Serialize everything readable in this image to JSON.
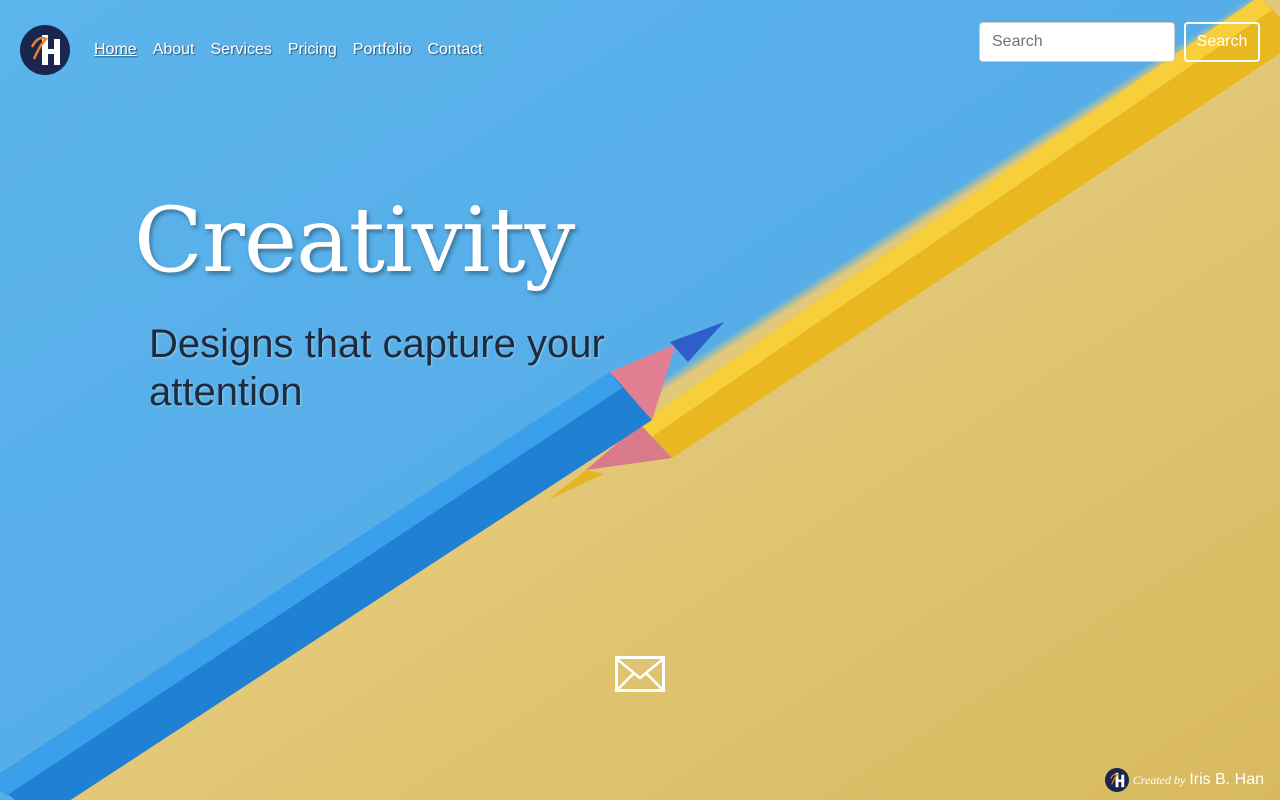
{
  "brand": {
    "logo_initials": "IBH"
  },
  "nav": {
    "items": [
      {
        "label": "Home",
        "active": true
      },
      {
        "label": "About"
      },
      {
        "label": "Services"
      },
      {
        "label": "Pricing"
      },
      {
        "label": "Portfolio"
      },
      {
        "label": "Contact"
      }
    ]
  },
  "search": {
    "placeholder": "Search",
    "value": "",
    "button_label": "Search"
  },
  "hero": {
    "title": "Creativity",
    "subtitle": "Designs that capture your attention",
    "contact_icon": "envelope-icon"
  },
  "footer": {
    "created_by_label": "Created by",
    "author": "Iris B. Han"
  },
  "colors": {
    "sky_blue": "#56ade8",
    "paper_yellow": "#dcc067",
    "pencil_blue": "#2a8fe0",
    "pencil_yellow": "#f0c22a",
    "logo_navy": "#1a2550",
    "logo_orange": "#e8822a",
    "tagline_text": "#1e2b3c"
  }
}
